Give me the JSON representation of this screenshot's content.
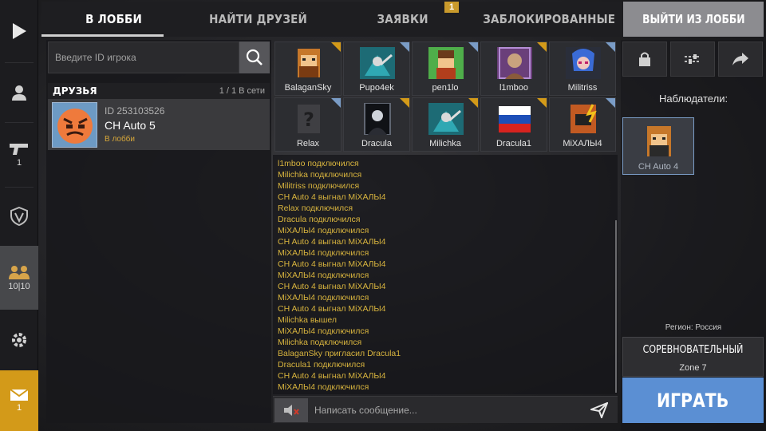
{
  "rail": {
    "items": [
      {
        "icon": "play-icon"
      },
      {
        "icon": "user-icon"
      },
      {
        "icon": "pistol-icon",
        "count": "1"
      },
      {
        "icon": "shield-icon"
      },
      {
        "icon": "group-icon",
        "count": "10|10"
      },
      {
        "icon": "gear-icon"
      },
      {
        "icon": "mail-icon",
        "count": "1"
      }
    ]
  },
  "tabs": [
    "В ЛОББИ",
    "НАЙТИ ДРУЗЕЙ",
    "ЗАЯВКИ",
    "ЗАБЛОКИРОВАННЫЕ"
  ],
  "requests_badge": "1",
  "leave_button": "ВЫЙТИ ИЗ ЛОББИ",
  "search": {
    "placeholder": "Введите ID игрока"
  },
  "friends": {
    "title": "ДРУЗЬЯ",
    "online": "1 / 1 В сети",
    "items": [
      {
        "id": "ID 253103526",
        "name": "CH Auto 5",
        "status": "В лобби"
      }
    ]
  },
  "players": [
    {
      "name": "BalaganSky",
      "corner": "#d39a19"
    },
    {
      "name": "Pupo4ek",
      "corner": "#7a9cc6"
    },
    {
      "name": "pen1lo",
      "corner": "#7a9cc6"
    },
    {
      "name": "l1mboo",
      "corner": "#d39a19"
    },
    {
      "name": "Militriss",
      "corner": "#7a9cc6"
    },
    {
      "name": "Relax",
      "corner": "#7a9cc6"
    },
    {
      "name": "Dracula",
      "corner": "#d39a19"
    },
    {
      "name": "Milichka",
      "corner": "#d39a19"
    },
    {
      "name": "Dracula1",
      "corner": "#d39a19"
    },
    {
      "name": "MiXAЛЫ4",
      "corner": "#7a9cc6"
    }
  ],
  "log": [
    "l1mboo подключился",
    "Milichka подключился",
    "Militriss подключился",
    "CH Auto 4 выгнал MiXAЛЫ4",
    "Relax подключился",
    "Dracula подключился",
    "MiXAЛЫ4 подключился",
    "CH Auto 4 выгнал MiXAЛЫ4",
    "MiXAЛЫ4 подключился",
    "CH Auto 4 выгнал MiXAЛЫ4",
    "MiXAЛЫ4 подключился",
    "CH Auto 4 выгнал MiXAЛЫ4",
    "MiXAЛЫ4 подключился",
    "CH Auto 4 выгнал MiXAЛЫ4",
    "Milichka вышел",
    "MiXAЛЫ4 подключился",
    "Milichka подключился",
    "BalaganSky пригласил Dracula1",
    "Dracula1 подключился",
    "CH Auto 4 выгнал MiXAЛЫ4",
    "MiXAЛЫ4 подключился"
  ],
  "chat": {
    "placeholder": "Написать сообщение..."
  },
  "observers": {
    "label": "Наблюдатели:",
    "items": [
      {
        "name": "CH Auto 4"
      }
    ]
  },
  "region": "Регион: Россия",
  "mode": {
    "title": "СОРЕВНОВАТЕЛЬНЫЙ",
    "map": "Zone 7"
  },
  "play_button": "ИГРАТЬ",
  "colors": {
    "accent": "#5b8fd3",
    "gold": "#d39a19",
    "log_text": "#d8b43e"
  }
}
